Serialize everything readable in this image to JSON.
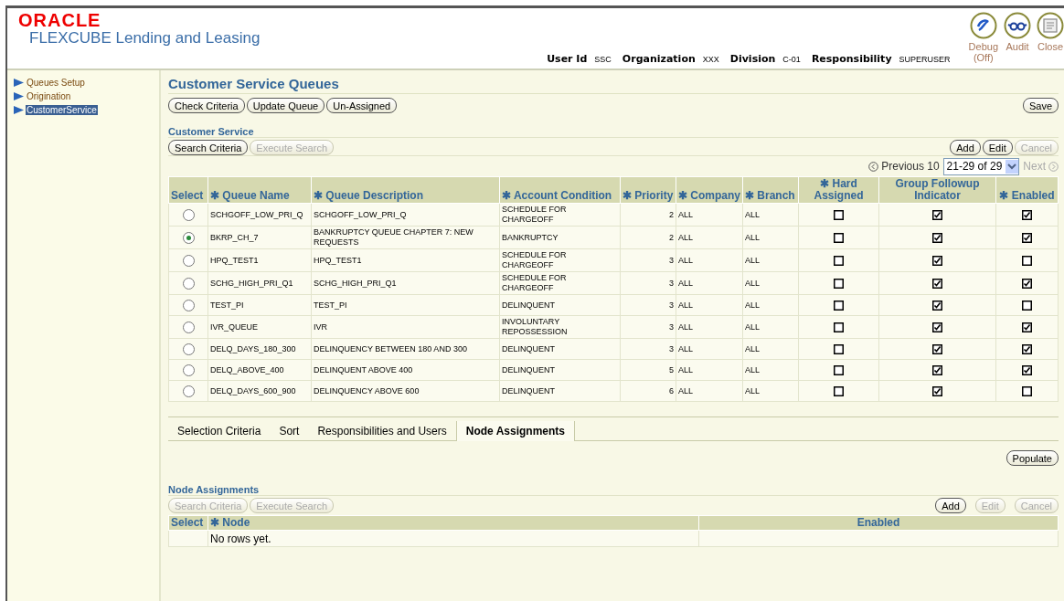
{
  "header": {
    "brand": "ORACLE",
    "product": "FLEXCUBE Lending and Leasing",
    "user_info": [
      {
        "label": "User Id",
        "value": "SSC"
      },
      {
        "label": "Organization",
        "value": "XXX"
      },
      {
        "label": "Division",
        "value": "C-01"
      },
      {
        "label": "Responsibility",
        "value": "SUPERUSER"
      }
    ],
    "actions": [
      {
        "kind": "debug",
        "label": "Debug",
        "sublabel": "(Off)"
      },
      {
        "kind": "audit",
        "label": "Audit"
      },
      {
        "kind": "close",
        "label": "Close"
      }
    ]
  },
  "sidebar": {
    "items": [
      {
        "label": "Queues Setup",
        "selected": false
      },
      {
        "label": "Origination",
        "selected": false
      },
      {
        "label": "CustomerService",
        "selected": true
      }
    ]
  },
  "page_title": "Customer Service Queues",
  "toolbar": [
    {
      "label": "Check Criteria",
      "disabled": false
    },
    {
      "label": "Update Queue",
      "disabled": false
    },
    {
      "label": "Un-Assigned",
      "disabled": false
    }
  ],
  "save": {
    "label": "Save",
    "disabled": false
  },
  "queues": {
    "title": "Customer Service",
    "search_buttons": [
      {
        "label": "Search Criteria",
        "disabled": false
      },
      {
        "label": "Execute Search",
        "disabled": true
      }
    ],
    "actions": [
      {
        "label": "Add",
        "disabled": false
      },
      {
        "label": "Edit",
        "disabled": false
      },
      {
        "label": "Cancel",
        "disabled": true
      }
    ],
    "pagination": {
      "previous": "Previous 10",
      "range": "21-29 of 29",
      "next": "Next",
      "next_disabled": true
    },
    "columns": [
      "Select",
      "✱ Queue Name",
      "✱ Queue Description",
      "✱ Account Condition",
      "✱ Priority",
      "✱ Company",
      "✱ Branch",
      "✱ Hard Assigned",
      "Group Followup Indicator",
      "✱ Enabled"
    ],
    "rows": [
      {
        "selected": false,
        "name": "SCHGOFF_LOW_PRI_Q",
        "description": "SCHGOFF_LOW_PRI_Q",
        "condition": "SCHEDULE FOR CHARGEOFF",
        "priority": "2",
        "company": "ALL",
        "branch": "ALL",
        "hard_assigned": false,
        "group_followup": true,
        "enabled": true
      },
      {
        "selected": true,
        "name": "BKRP_CH_7",
        "description": "BANKRUPTCY QUEUE CHAPTER 7: NEW REQUESTS",
        "condition": "BANKRUPTCY",
        "priority": "2",
        "company": "ALL",
        "branch": "ALL",
        "hard_assigned": false,
        "group_followup": true,
        "enabled": true
      },
      {
        "selected": false,
        "name": "HPQ_TEST1",
        "description": "HPQ_TEST1",
        "condition": "SCHEDULE FOR CHARGEOFF",
        "priority": "3",
        "company": "ALL",
        "branch": "ALL",
        "hard_assigned": false,
        "group_followup": true,
        "enabled": false
      },
      {
        "selected": false,
        "name": "SCHG_HIGH_PRI_Q1",
        "description": "SCHG_HIGH_PRI_Q1",
        "condition": "SCHEDULE FOR CHARGEOFF",
        "priority": "3",
        "company": "ALL",
        "branch": "ALL",
        "hard_assigned": false,
        "group_followup": true,
        "enabled": true
      },
      {
        "selected": false,
        "name": "TEST_PI",
        "description": "TEST_PI",
        "condition": "DELINQUENT",
        "priority": "3",
        "company": "ALL",
        "branch": "ALL",
        "hard_assigned": false,
        "group_followup": true,
        "enabled": false
      },
      {
        "selected": false,
        "name": "IVR_QUEUE",
        "description": "IVR",
        "condition": "INVOLUNTARY REPOSSESSION",
        "priority": "3",
        "company": "ALL",
        "branch": "ALL",
        "hard_assigned": false,
        "group_followup": true,
        "enabled": true
      },
      {
        "selected": false,
        "name": "DELQ_DAYS_180_300",
        "description": "DELINQUENCY BETWEEN 180 AND 300",
        "condition": "DELINQUENT",
        "priority": "3",
        "company": "ALL",
        "branch": "ALL",
        "hard_assigned": false,
        "group_followup": true,
        "enabled": true
      },
      {
        "selected": false,
        "name": "DELQ_ABOVE_400",
        "description": "DELINQUENT ABOVE 400",
        "condition": "DELINQUENT",
        "priority": "5",
        "company": "ALL",
        "branch": "ALL",
        "hard_assigned": false,
        "group_followup": true,
        "enabled": true
      },
      {
        "selected": false,
        "name": "DELQ_DAYS_600_900",
        "description": "DELINQUENCY ABOVE 600",
        "condition": "DELINQUENT",
        "priority": "6",
        "company": "ALL",
        "branch": "ALL",
        "hard_assigned": false,
        "group_followup": true,
        "enabled": false
      }
    ]
  },
  "tabs": [
    {
      "label": "Selection Criteria",
      "selected": false
    },
    {
      "label": "Sort",
      "selected": false
    },
    {
      "label": "Responsibilities and Users",
      "selected": false
    },
    {
      "label": "Node Assignments",
      "selected": true
    }
  ],
  "populate": {
    "label": "Populate",
    "disabled": false
  },
  "nodes": {
    "title": "Node Assignments",
    "search_buttons": [
      {
        "label": "Search Criteria",
        "disabled": true
      },
      {
        "label": "Execute Search",
        "disabled": true
      }
    ],
    "actions": [
      {
        "label": "Add",
        "disabled": false
      },
      {
        "label": "Edit",
        "disabled": true
      },
      {
        "label": "Cancel",
        "disabled": true
      }
    ],
    "columns": [
      "Select",
      "✱ Node",
      "Enabled"
    ],
    "empty": "No rows yet."
  }
}
